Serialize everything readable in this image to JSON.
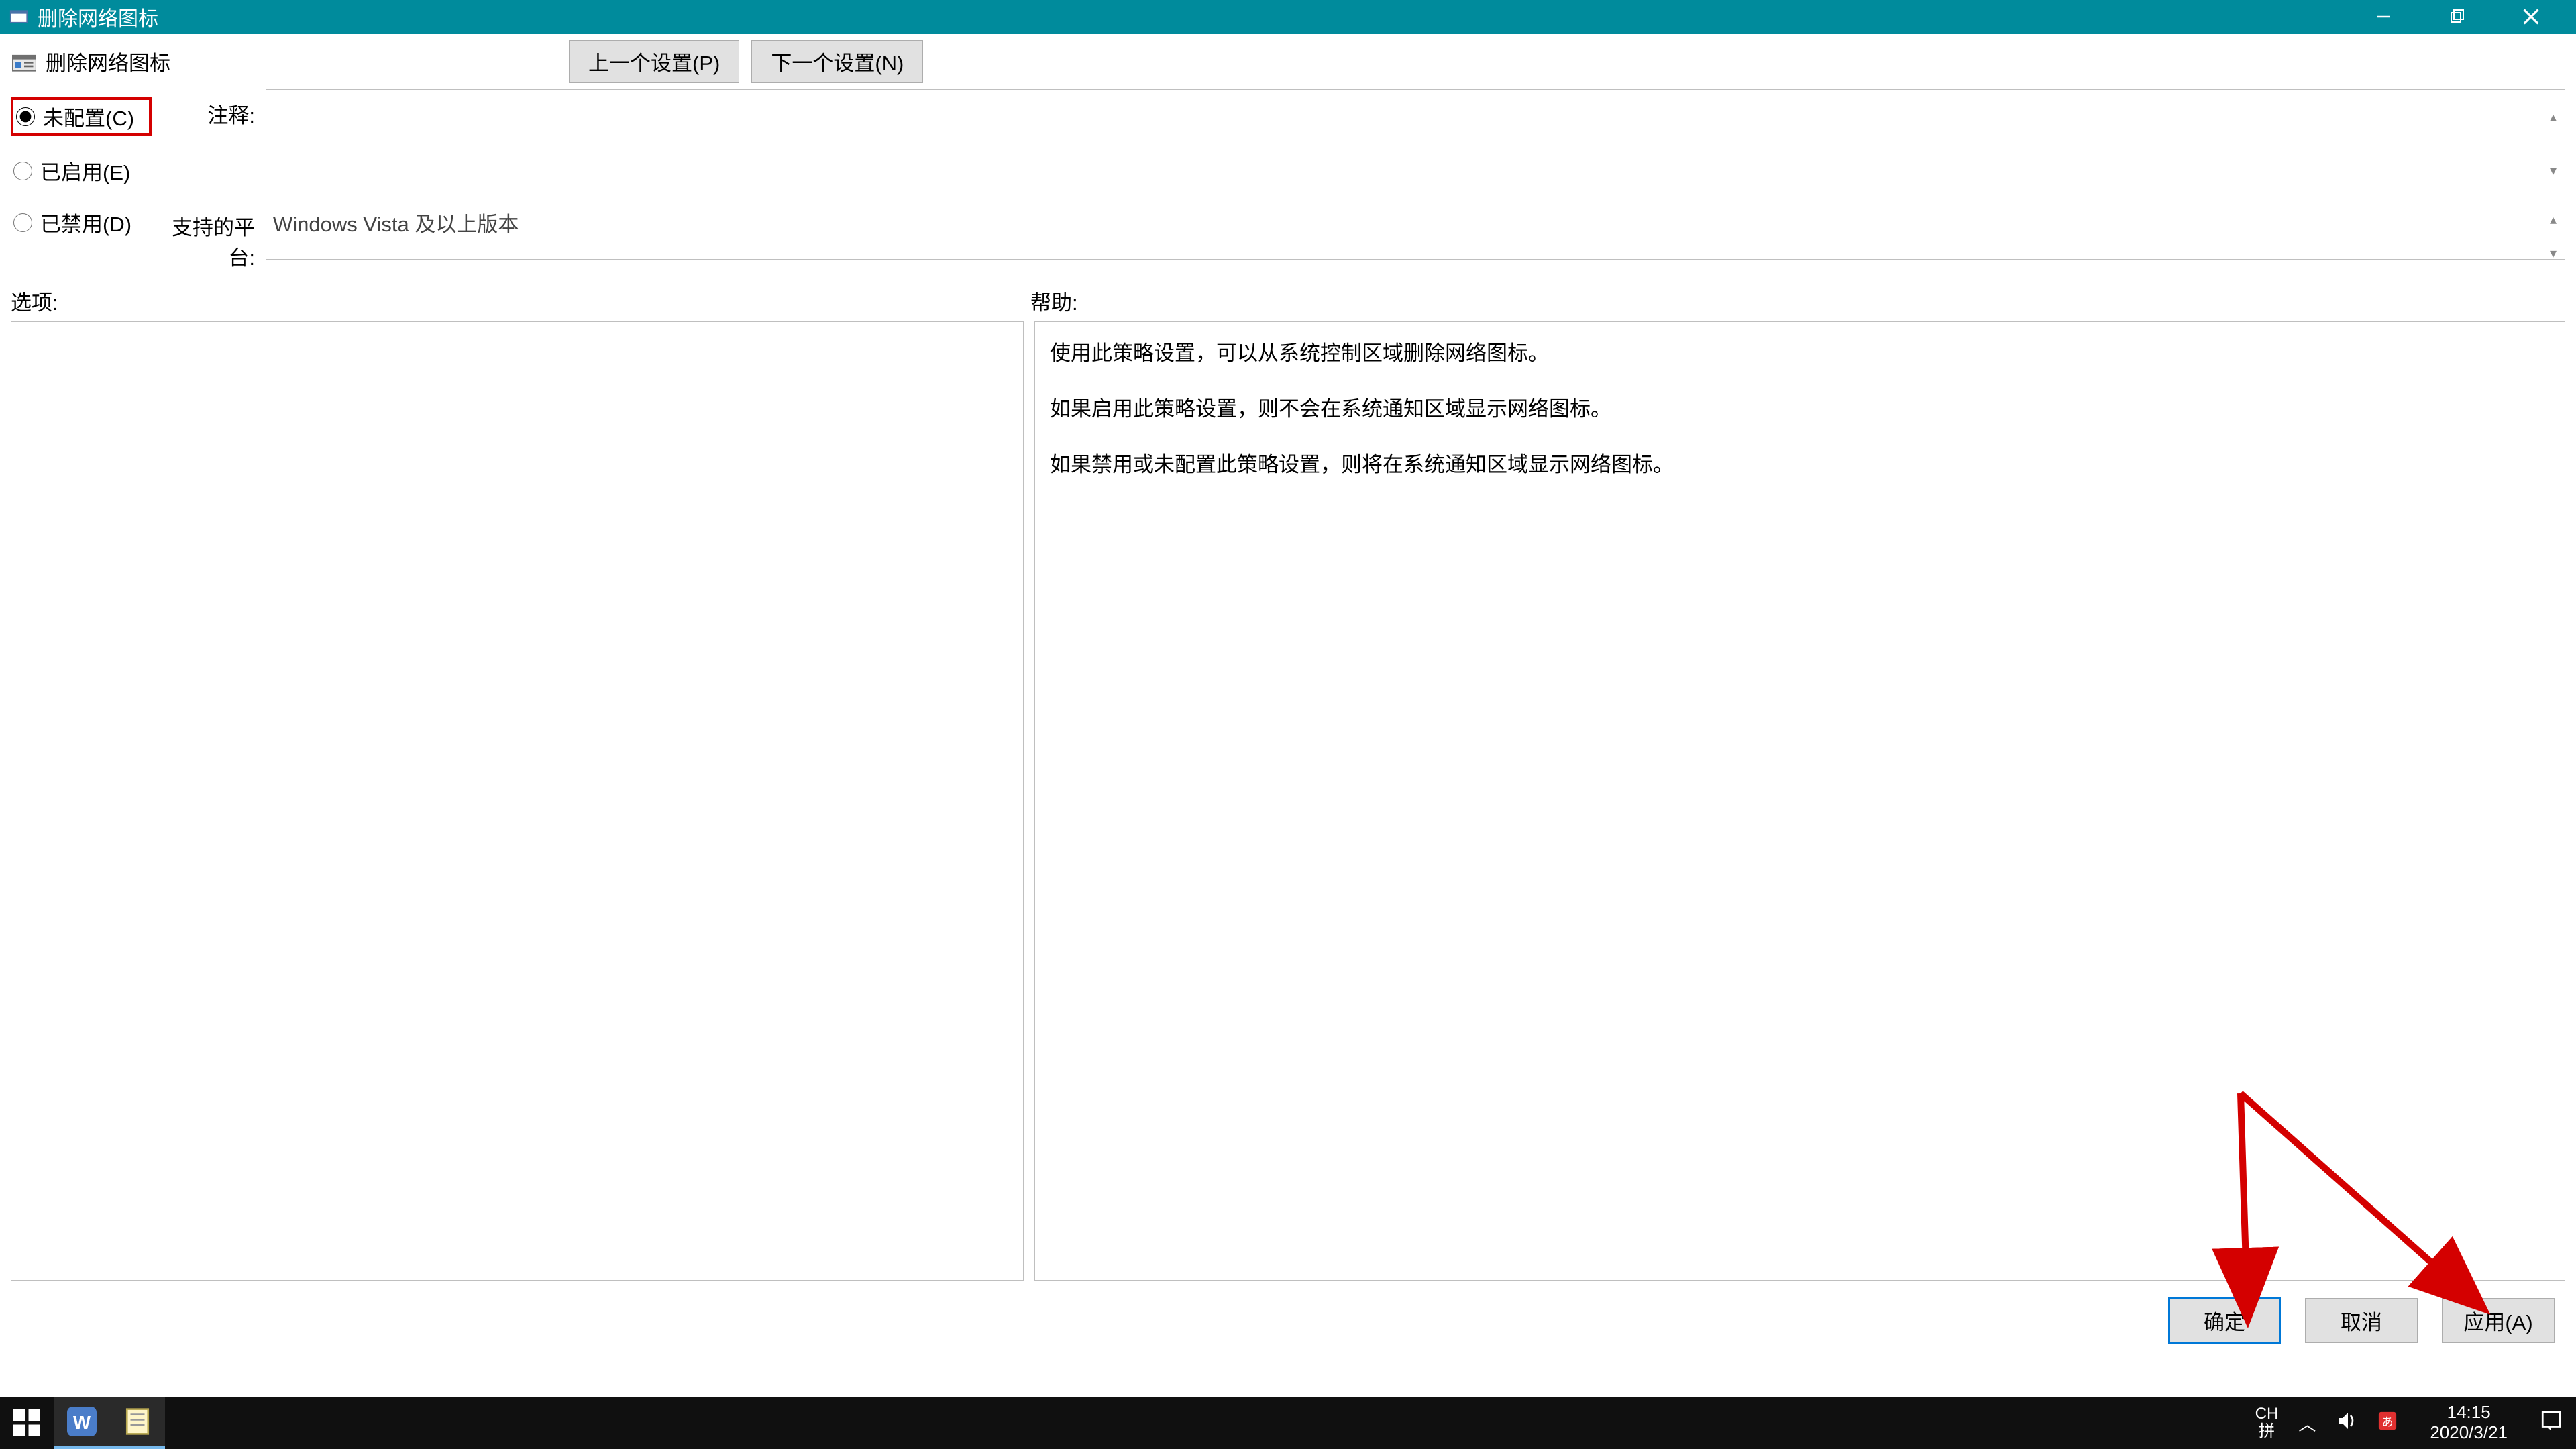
{
  "window": {
    "title": "删除网络图标"
  },
  "header": {
    "policy_name": "删除网络图标",
    "prev_setting": "上一个设置(P)",
    "next_setting": "下一个设置(N)"
  },
  "radios": {
    "not_configured": "未配置(C)",
    "enabled": "已启用(E)",
    "disabled": "已禁用(D)",
    "selected": "not_configured"
  },
  "labels": {
    "comment": "注释:",
    "supported": "支持的平台:",
    "options": "选项:",
    "help": "帮助:"
  },
  "fields": {
    "comment_value": "",
    "supported_value": "Windows Vista 及以上版本"
  },
  "help_text": {
    "p1": "使用此策略设置，可以从系统控制区域删除网络图标。",
    "p2": "如果启用此策略设置，则不会在系统通知区域显示网络图标。",
    "p3": "如果禁用或未配置此策略设置，则将在系统通知区域显示网络图标。"
  },
  "buttons": {
    "ok": "确定",
    "cancel": "取消",
    "apply": "应用(A)"
  },
  "taskbar": {
    "lang": "CH",
    "ime": "拼",
    "time": "14:15",
    "date": "2020/3/21"
  }
}
